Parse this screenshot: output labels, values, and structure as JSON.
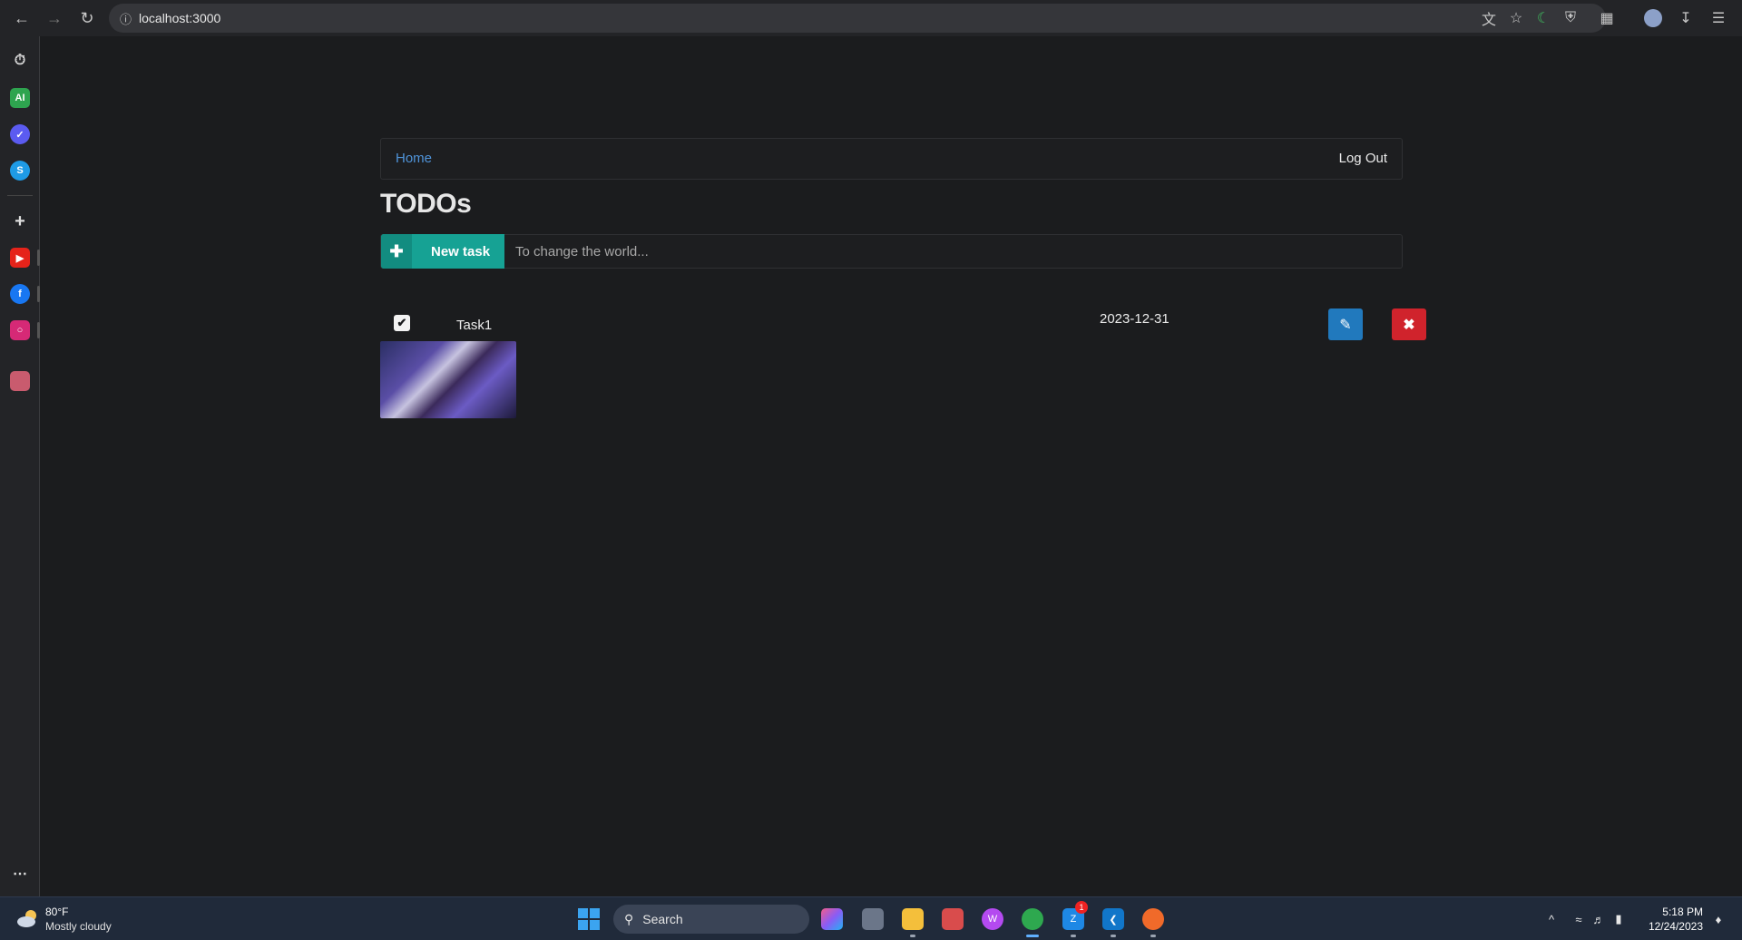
{
  "browser": {
    "url": "localhost:3000"
  },
  "app": {
    "nav": {
      "home": "Home",
      "logout": "Log Out"
    },
    "title": "TODOs",
    "new_task": {
      "button_label": "New task",
      "input_placeholder": "To change the world..."
    },
    "tasks": [
      {
        "name": "Task1",
        "date": "2023-12-31",
        "completed": true
      }
    ]
  },
  "sidebar": {
    "items": [
      "history",
      "ai-assistant",
      "messenger",
      "skype",
      "add",
      "youtube",
      "facebook",
      "instagram",
      "profile"
    ]
  },
  "taskbar": {
    "weather": {
      "temp": "80°F",
      "desc": "Mostly cloudy"
    },
    "search_label": "Search",
    "badge_count": "1",
    "clock": {
      "time": "5:18 PM",
      "date": "12/24/2023"
    }
  },
  "colors": {
    "accent_teal": "#16a294",
    "edit_blue": "#2179bd",
    "delete_red": "#d0232c",
    "link_blue": "#4f93d8"
  }
}
